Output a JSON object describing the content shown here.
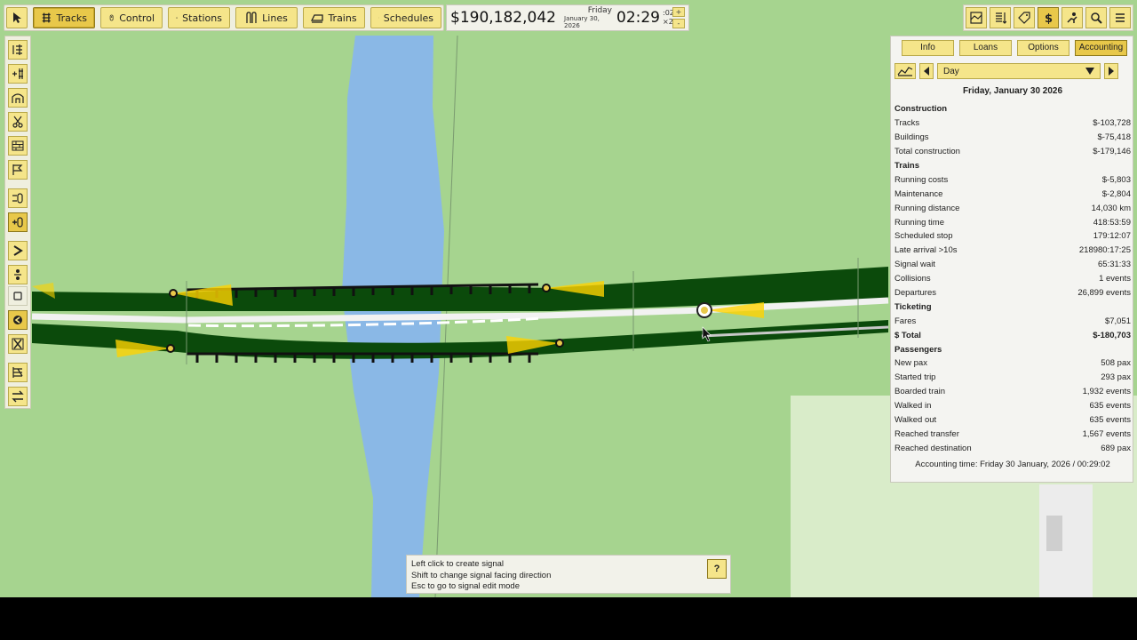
{
  "toolbar": {
    "tracks_label": "Tracks",
    "control_label": "Control",
    "stations_label": "Stations",
    "lines_label": "Lines",
    "trains_label": "Trains",
    "schedules_label": "Schedules"
  },
  "status": {
    "money": "$190,182,042",
    "day_name": "Friday",
    "date": "January 30, 2026",
    "time": "02:29",
    "seconds": ":02",
    "speed": "×2",
    "speed_up": "+",
    "speed_down": "-"
  },
  "accounting": {
    "tabs": [
      "Info",
      "Loans",
      "Options",
      "Accounting"
    ],
    "period": "Day",
    "date_heading": "Friday, January 30 2026",
    "rows": [
      {
        "label": "Construction",
        "value": "",
        "heading": true
      },
      {
        "label": "Tracks",
        "value": "$-103,728"
      },
      {
        "label": "Buildings",
        "value": "$-75,418"
      },
      {
        "label": "Total construction",
        "value": "$-179,146"
      },
      {
        "label": "Trains",
        "value": "",
        "heading": true
      },
      {
        "label": "Running costs",
        "value": "$-5,803"
      },
      {
        "label": "Maintenance",
        "value": "$-2,804"
      },
      {
        "label": "Running distance",
        "value": "14,030 km"
      },
      {
        "label": "Running time",
        "value": "418:53:59"
      },
      {
        "label": "Scheduled stop",
        "value": "179:12:07"
      },
      {
        "label": "Late arrival >10s",
        "value": "218980:17:25"
      },
      {
        "label": "Signal wait",
        "value": "65:31:33"
      },
      {
        "label": "Collisions",
        "value": "1 events"
      },
      {
        "label": "Departures",
        "value": "26,899 events"
      },
      {
        "label": "Ticketing",
        "value": "",
        "heading": true
      },
      {
        "label": "Fares",
        "value": "$7,051"
      },
      {
        "label": "$ Total",
        "value": "$-180,703",
        "heading": true
      },
      {
        "label": "Passengers",
        "value": "",
        "heading": true
      },
      {
        "label": "New pax",
        "value": "508 pax"
      },
      {
        "label": "Started trip",
        "value": "293 pax"
      },
      {
        "label": "Boarded train",
        "value": "1,932 events"
      },
      {
        "label": "Walked in",
        "value": "635 events"
      },
      {
        "label": "Walked out",
        "value": "635 events"
      },
      {
        "label": "Reached transfer",
        "value": "1,567 events"
      },
      {
        "label": "Reached destination",
        "value": "689 pax"
      }
    ],
    "footer": "Accounting time: Friday 30 January, 2026 / 00:29:02"
  },
  "hint": {
    "line1": "Left click to create signal",
    "line2": "Shift to change signal facing direction",
    "line3": "Esc to go to signal edit mode",
    "help": "?"
  },
  "colors": {
    "grass": "#a6d48f",
    "river": "#8ab8e6",
    "track_bed": "#0b4a0b",
    "button": "#f5e58a",
    "button_active": "#e8c84a"
  }
}
